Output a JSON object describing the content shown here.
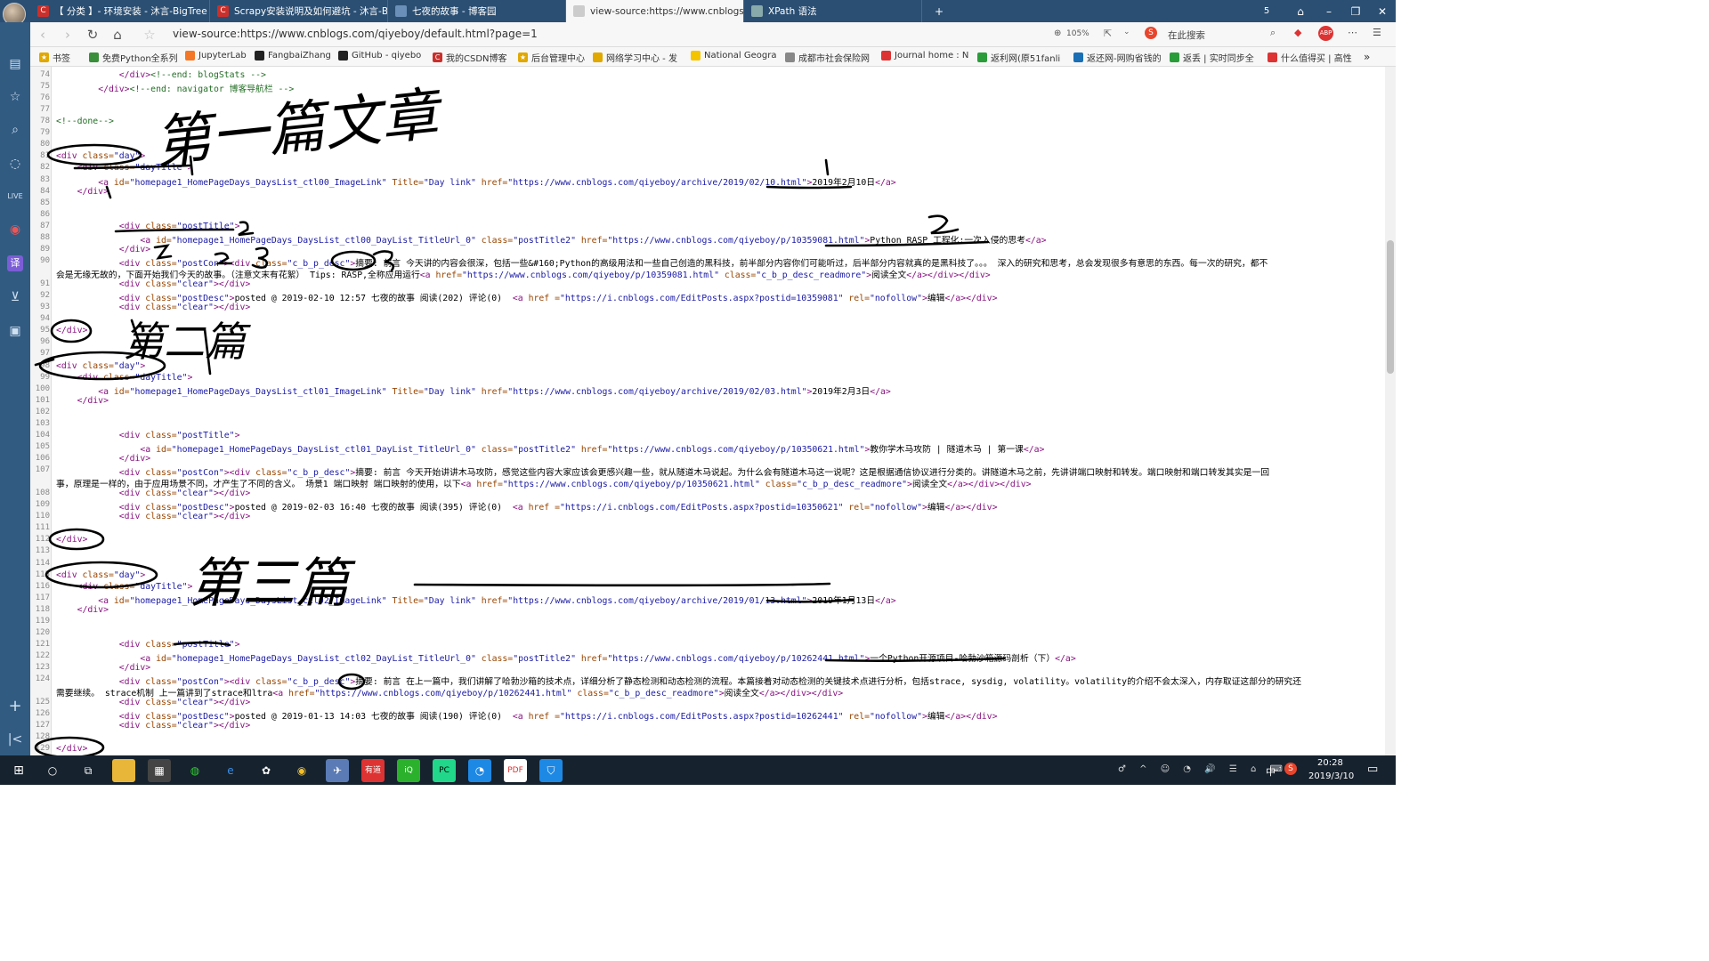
{
  "tabs": [
    {
      "title": "【 分类 】- 环境安装 - 沐言-BigTree",
      "icon": "C"
    },
    {
      "title": "Scrapy安装说明及如何避坑 - 沐言-BigTree",
      "icon": "C"
    },
    {
      "title": "七夜的故事 - 博客园",
      "icon": ""
    },
    {
      "title": "view-source:https://www.cnblogs.com",
      "icon": ""
    },
    {
      "title": "XPath 语法",
      "icon": ""
    }
  ],
  "tab_count": "5",
  "address": {
    "url": "view-source:https://www.cnblogs.com/qiyeboy/default.html?page=1",
    "zoom": "105%",
    "search_placeholder": "在此搜索"
  },
  "bookmarks": [
    "书签",
    "免费Python全系列",
    "JupyterLab",
    "FangbaiZhang",
    "GitHub - qiyebo",
    "我的CSDN博客",
    "后台管理中心",
    "网络学习中心 - 发",
    "National Geogra",
    "成都市社会保险网",
    "Journal home : N",
    "返利网(原51fanli",
    "返还网-网购省钱的",
    "返丢 | 实时同步全",
    "什么值得买 | 高性"
  ],
  "code_lines": [
    {
      "n": "74",
      "html": "            <span class=\"tag\">&lt;/div&gt;</span><span class=\"cm\">&lt;!--end: blogStats --&gt;</span>"
    },
    {
      "n": "75",
      "html": "        <span class=\"tag\">&lt;/div&gt;</span><span class=\"cm\">&lt;!--end: navigator 博客导航栏 --&gt;</span>"
    },
    {
      "n": "76",
      "html": ""
    },
    {
      "n": "77",
      "html": ""
    },
    {
      "n": "78",
      "html": "<span class=\"cm\">&lt;!--done--&gt;</span>"
    },
    {
      "n": "79",
      "html": ""
    },
    {
      "n": "80",
      "html": ""
    },
    {
      "n": "81",
      "html": "<span class=\"tag\">&lt;div</span> <span class=\"attr\">class=</span><span class=\"val\">\"day\"</span><span class=\"tag\">&gt;</span>"
    },
    {
      "n": "82",
      "html": "    <span class=\"tag\">&lt;div</span> <span class=\"attr\">class=</span><span class=\"val\">\"dayTitle\"</span><span class=\"tag\">&gt;</span>"
    },
    {
      "n": "83",
      "html": "        <span class=\"tag\">&lt;a</span> <span class=\"attr\">id=</span><span class=\"val\">\"homepage1_HomePageDays_DaysList_ctl00_ImageLink\"</span> <span class=\"attr\">Title=</span><span class=\"val\">\"Day link\"</span> <span class=\"attr\">href=</span><span class=\"val\">\"https://www.cnblogs.com/qiyeboy/archive/2019/02/10.html\"</span><span class=\"tag\">&gt;</span><span class=\"txt\">2019年2月10日</span><span class=\"tag\">&lt;/a&gt;</span>"
    },
    {
      "n": "84",
      "html": "    <span class=\"tag\">&lt;/div&gt;</span>"
    },
    {
      "n": "85",
      "html": ""
    },
    {
      "n": "86",
      "html": ""
    },
    {
      "n": "87",
      "html": "            <span class=\"tag\">&lt;div</span> <span class=\"attr\">class=</span><span class=\"val\">\"postTitle\"</span><span class=\"tag\">&gt;</span>"
    },
    {
      "n": "88",
      "html": "                <span class=\"tag\">&lt;a</span> <span class=\"attr\">id=</span><span class=\"val\">\"homepage1_HomePageDays_DaysList_ctl00_DayList_TitleUrl_0\"</span> <span class=\"attr\">class=</span><span class=\"val\">\"postTitle2\"</span> <span class=\"attr\">href=</span><span class=\"val\">\"https://www.cnblogs.com/qiyeboy/p/10359081.html\"</span><span class=\"tag\">&gt;</span><span class=\"txt\">Python RASP 工程化:一次入侵的思考</span><span class=\"tag\">&lt;/a&gt;</span>"
    },
    {
      "n": "89",
      "html": "            <span class=\"tag\">&lt;/div&gt;</span>"
    },
    {
      "n": "90",
      "html": "            <span class=\"tag\">&lt;div</span> <span class=\"attr\">class=</span><span class=\"val\">\"postCon\"</span><span class=\"tag\">&gt;&lt;div</span> <span class=\"attr\">class=</span><span class=\"val\">\"c_b_p_desc\"</span><span class=\"tag\">&gt;</span><span class=\"txt\">摘要: 前言 今天讲的内容会很深，包括一些&amp;#160;Python的高级用法和一些自己创造的黑科技，前半部分内容你们可能听过，后半部分内容就真的是黑科技了。。。 深入的研究和思考，总会发现很多有意思的东西。每一次的研究，都不</span>"
    },
    {
      "n": "",
      "html": "<span class=\"txt\">会是无缘无故的，下面开始我们今天的故事。（注意文末有花絮） Tips: RASP,全称应用运行</span><span class=\"tag\">&lt;a</span> <span class=\"attr\">href=</span><span class=\"val\">\"https://www.cnblogs.com/qiyeboy/p/10359081.html\"</span> <span class=\"attr\">class=</span><span class=\"val\">\"c_b_p_desc_readmore\"</span><span class=\"tag\">&gt;</span><span class=\"txt\">阅读全文</span><span class=\"tag\">&lt;/a&gt;&lt;/div&gt;&lt;/div&gt;</span>"
    },
    {
      "n": "91",
      "html": "            <span class=\"tag\">&lt;div</span> <span class=\"attr\">class=</span><span class=\"val\">\"clear\"</span><span class=\"tag\">&gt;&lt;/div&gt;</span>"
    },
    {
      "n": "92",
      "html": "            <span class=\"tag\">&lt;div</span> <span class=\"attr\">class=</span><span class=\"val\">\"postDesc\"</span><span class=\"tag\">&gt;</span><span class=\"txt\">posted @ 2019-02-10 12:57 七夜的故事 阅读(202) 评论(0)  </span><span class=\"tag\">&lt;a</span> <span class=\"attr\">href</span> <span class=\"attr\">=</span><span class=\"val\">\"https://i.cnblogs.com/EditPosts.aspx?postid=10359081\"</span> <span class=\"attr\">rel=</span><span class=\"val\">\"nofollow\"</span><span class=\"tag\">&gt;</span><span class=\"txt\">编辑</span><span class=\"tag\">&lt;/a&gt;&lt;/div&gt;</span>"
    },
    {
      "n": "93",
      "html": "            <span class=\"tag\">&lt;div</span> <span class=\"attr\">class=</span><span class=\"val\">\"clear\"</span><span class=\"tag\">&gt;&lt;/div&gt;</span>"
    },
    {
      "n": "94",
      "html": ""
    },
    {
      "n": "95",
      "html": "<span class=\"tag\">&lt;/div&gt;</span>"
    },
    {
      "n": "96",
      "html": ""
    },
    {
      "n": "97",
      "html": ""
    },
    {
      "n": "98",
      "html": "<span class=\"tag\">&lt;div</span> <span class=\"attr\">class=</span><span class=\"val\">\"day\"</span><span class=\"tag\">&gt;</span>"
    },
    {
      "n": "99",
      "html": "    <span class=\"tag\">&lt;div</span> <span class=\"attr\">class=</span><span class=\"val\">\"dayTitle\"</span><span class=\"tag\">&gt;</span>"
    },
    {
      "n": "100",
      "html": "        <span class=\"tag\">&lt;a</span> <span class=\"attr\">id=</span><span class=\"val\">\"homepage1_HomePageDays_DaysList_ctl01_ImageLink\"</span> <span class=\"attr\">Title=</span><span class=\"val\">\"Day link\"</span> <span class=\"attr\">href=</span><span class=\"val\">\"https://www.cnblogs.com/qiyeboy/archive/2019/02/03.html\"</span><span class=\"tag\">&gt;</span><span class=\"txt\">2019年2月3日</span><span class=\"tag\">&lt;/a&gt;</span>"
    },
    {
      "n": "101",
      "html": "    <span class=\"tag\">&lt;/div&gt;</span>"
    },
    {
      "n": "102",
      "html": ""
    },
    {
      "n": "103",
      "html": ""
    },
    {
      "n": "104",
      "html": "            <span class=\"tag\">&lt;div</span> <span class=\"attr\">class=</span><span class=\"val\">\"postTitle\"</span><span class=\"tag\">&gt;</span>"
    },
    {
      "n": "105",
      "html": "                <span class=\"tag\">&lt;a</span> <span class=\"attr\">id=</span><span class=\"val\">\"homepage1_HomePageDays_DaysList_ctl01_DayList_TitleUrl_0\"</span> <span class=\"attr\">class=</span><span class=\"val\">\"postTitle2\"</span> <span class=\"attr\">href=</span><span class=\"val\">\"https://www.cnblogs.com/qiyeboy/p/10350621.html\"</span><span class=\"tag\">&gt;</span><span class=\"txt\">教你学木马攻防 | 隧道木马 | 第一课</span><span class=\"tag\">&lt;/a&gt;</span>"
    },
    {
      "n": "106",
      "html": "            <span class=\"tag\">&lt;/div&gt;</span>"
    },
    {
      "n": "107",
      "html": "            <span class=\"tag\">&lt;div</span> <span class=\"attr\">class=</span><span class=\"val\">\"postCon\"</span><span class=\"tag\">&gt;&lt;div</span> <span class=\"attr\">class=</span><span class=\"val\">\"c_b_p_desc\"</span><span class=\"tag\">&gt;</span><span class=\"txt\">摘要: 前言 今天开始讲讲木马攻防，感觉这些内容大家应该会更感兴趣一些，就从隧道木马说起。为什么会有隧道木马这一说呢？这是根据通信协议进行分类的。讲隧道木马之前，先讲讲端口映射和转发。端口映射和端口转发其实是一回</span>"
    },
    {
      "n": "",
      "html": "<span class=\"txt\">事，原理是一样的，由于应用场景不同，才产生了不同的含义。 场景1 端口映射 端口映射的使用，以下</span><span class=\"tag\">&lt;a</span> <span class=\"attr\">href=</span><span class=\"val\">\"https://www.cnblogs.com/qiyeboy/p/10350621.html\"</span> <span class=\"attr\">class=</span><span class=\"val\">\"c_b_p_desc_readmore\"</span><span class=\"tag\">&gt;</span><span class=\"txt\">阅读全文</span><span class=\"tag\">&lt;/a&gt;&lt;/div&gt;&lt;/div&gt;</span>"
    },
    {
      "n": "108",
      "html": "            <span class=\"tag\">&lt;div</span> <span class=\"attr\">class=</span><span class=\"val\">\"clear\"</span><span class=\"tag\">&gt;&lt;/div&gt;</span>"
    },
    {
      "n": "109",
      "html": "            <span class=\"tag\">&lt;div</span> <span class=\"attr\">class=</span><span class=\"val\">\"postDesc\"</span><span class=\"tag\">&gt;</span><span class=\"txt\">posted @ 2019-02-03 16:40 七夜的故事 阅读(395) 评论(0)  </span><span class=\"tag\">&lt;a</span> <span class=\"attr\">href</span> <span class=\"attr\">=</span><span class=\"val\">\"https://i.cnblogs.com/EditPosts.aspx?postid=10350621\"</span> <span class=\"attr\">rel=</span><span class=\"val\">\"nofollow\"</span><span class=\"tag\">&gt;</span><span class=\"txt\">编辑</span><span class=\"tag\">&lt;/a&gt;&lt;/div&gt;</span>"
    },
    {
      "n": "110",
      "html": "            <span class=\"tag\">&lt;div</span> <span class=\"attr\">class=</span><span class=\"val\">\"clear\"</span><span class=\"tag\">&gt;&lt;/div&gt;</span>"
    },
    {
      "n": "111",
      "html": ""
    },
    {
      "n": "112",
      "html": "<span class=\"tag\">&lt;/div&gt;</span>"
    },
    {
      "n": "113",
      "html": ""
    },
    {
      "n": "114",
      "html": ""
    },
    {
      "n": "115",
      "html": "<span class=\"tag\">&lt;div</span> <span class=\"attr\">class=</span><span class=\"val\">\"day\"</span><span class=\"tag\">&gt;</span>"
    },
    {
      "n": "116",
      "html": "    <span class=\"tag\">&lt;div</span> <span class=\"attr\">class=</span><span class=\"val\">\"dayTitle\"</span><span class=\"tag\">&gt;</span>"
    },
    {
      "n": "117",
      "html": "        <span class=\"tag\">&lt;a</span> <span class=\"attr\">id=</span><span class=\"val\">\"homepage1_HomePageDays_DaysList_ctl02_ImageLink\"</span> <span class=\"attr\">Title=</span><span class=\"val\">\"Day link\"</span> <span class=\"attr\">href=</span><span class=\"val\">\"https://www.cnblogs.com/qiyeboy/archive/2019/01/13.html\"</span><span class=\"tag\">&gt;</span><span class=\"txt\">2019年1月13日</span><span class=\"tag\">&lt;/a&gt;</span>"
    },
    {
      "n": "118",
      "html": "    <span class=\"tag\">&lt;/div&gt;</span>"
    },
    {
      "n": "119",
      "html": ""
    },
    {
      "n": "120",
      "html": ""
    },
    {
      "n": "121",
      "html": "            <span class=\"tag\">&lt;div</span> <span class=\"attr\">class=</span><span class=\"val\">\"postTitle\"</span><span class=\"tag\">&gt;</span>"
    },
    {
      "n": "122",
      "html": "                <span class=\"tag\">&lt;a</span> <span class=\"attr\">id=</span><span class=\"val\">\"homepage1_HomePageDays_DaysList_ctl02_DayList_TitleUrl_0\"</span> <span class=\"attr\">class=</span><span class=\"val\">\"postTitle2\"</span> <span class=\"attr\">href=</span><span class=\"val\">\"https://www.cnblogs.com/qiyeboy/p/10262441.html\"</span><span class=\"tag\">&gt;</span><span class=\"txt\">一个Python开源项目-哈勃沙箱源码剖析（下）</span><span class=\"tag\">&lt;/a&gt;</span>"
    },
    {
      "n": "123",
      "html": "            <span class=\"tag\">&lt;/div&gt;</span>"
    },
    {
      "n": "124",
      "html": "            <span class=\"tag\">&lt;div</span> <span class=\"attr\">class=</span><span class=\"val\">\"postCon\"</span><span class=\"tag\">&gt;&lt;div</span> <span class=\"attr\">class=</span><span class=\"val\">\"c_b_p_desc\"</span><span class=\"tag\">&gt;</span><span class=\"txt\">摘要: 前言 在上一篇中，我们讲解了哈勃沙箱的技术点，详细分析了静态检测和动态检测的流程。本篇接着对动态检测的关键技术点进行分析，包括strace, sysdig, volatility。volatility的介绍不会太深入，内存取证这部分的研究还</span>"
    },
    {
      "n": "",
      "html": "<span class=\"txt\">需要继续。 strace机制 上一篇讲到了strace和ltra</span><span class=\"tag\">&lt;a</span> <span class=\"attr\">href=</span><span class=\"val\">\"https://www.cnblogs.com/qiyeboy/p/10262441.html\"</span> <span class=\"attr\">class=</span><span class=\"val\">\"c_b_p_desc_readmore\"</span><span class=\"tag\">&gt;</span><span class=\"txt\">阅读全文</span><span class=\"tag\">&lt;/a&gt;&lt;/div&gt;&lt;/div&gt;</span>"
    },
    {
      "n": "125",
      "html": "            <span class=\"tag\">&lt;div</span> <span class=\"attr\">class=</span><span class=\"val\">\"clear\"</span><span class=\"tag\">&gt;&lt;/div&gt;</span>"
    },
    {
      "n": "126",
      "html": "            <span class=\"tag\">&lt;div</span> <span class=\"attr\">class=</span><span class=\"val\">\"postDesc\"</span><span class=\"tag\">&gt;</span><span class=\"txt\">posted @ 2019-01-13 14:03 七夜的故事 阅读(190) 评论(0)  </span><span class=\"tag\">&lt;a</span> <span class=\"attr\">href</span> <span class=\"attr\">=</span><span class=\"val\">\"https://i.cnblogs.com/EditPosts.aspx?postid=10262441\"</span> <span class=\"attr\">rel=</span><span class=\"val\">\"nofollow\"</span><span class=\"tag\">&gt;</span><span class=\"txt\">编辑</span><span class=\"tag\">&lt;/a&gt;&lt;/div&gt;</span>"
    },
    {
      "n": "127",
      "html": "            <span class=\"tag\">&lt;div</span> <span class=\"attr\">class=</span><span class=\"val\">\"clear\"</span><span class=\"tag\">&gt;&lt;/div&gt;</span>"
    },
    {
      "n": "128",
      "html": ""
    },
    {
      "n": "129",
      "html": "<span class=\"tag\">&lt;/div&gt;</span>"
    }
  ],
  "annotations": {
    "first": "第一篇文章",
    "second": "第二篇",
    "third": "第三篇"
  },
  "taskbar": {
    "time": "20:28",
    "date": "2019/3/10",
    "ime": "中"
  }
}
